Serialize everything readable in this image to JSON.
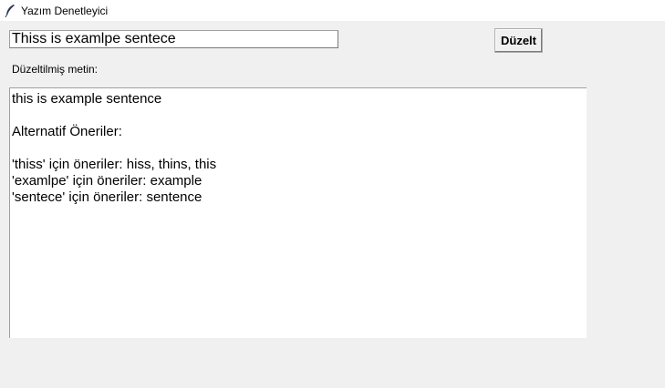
{
  "window": {
    "title": "Yazım Denetleyici",
    "icon": "feather-icon"
  },
  "input": {
    "value": "Thiss is examlpe sentece"
  },
  "button": {
    "label": "Düzelt"
  },
  "output_label": "Düzeltilmiş metin:",
  "output": {
    "lines": [
      "this is example sentence",
      "",
      "Alternatif Öneriler:",
      "",
      "'thiss' için öneriler: hiss, thins, this",
      "'examlpe' için öneriler: example",
      "'sentece' için öneriler: sentence"
    ]
  }
}
